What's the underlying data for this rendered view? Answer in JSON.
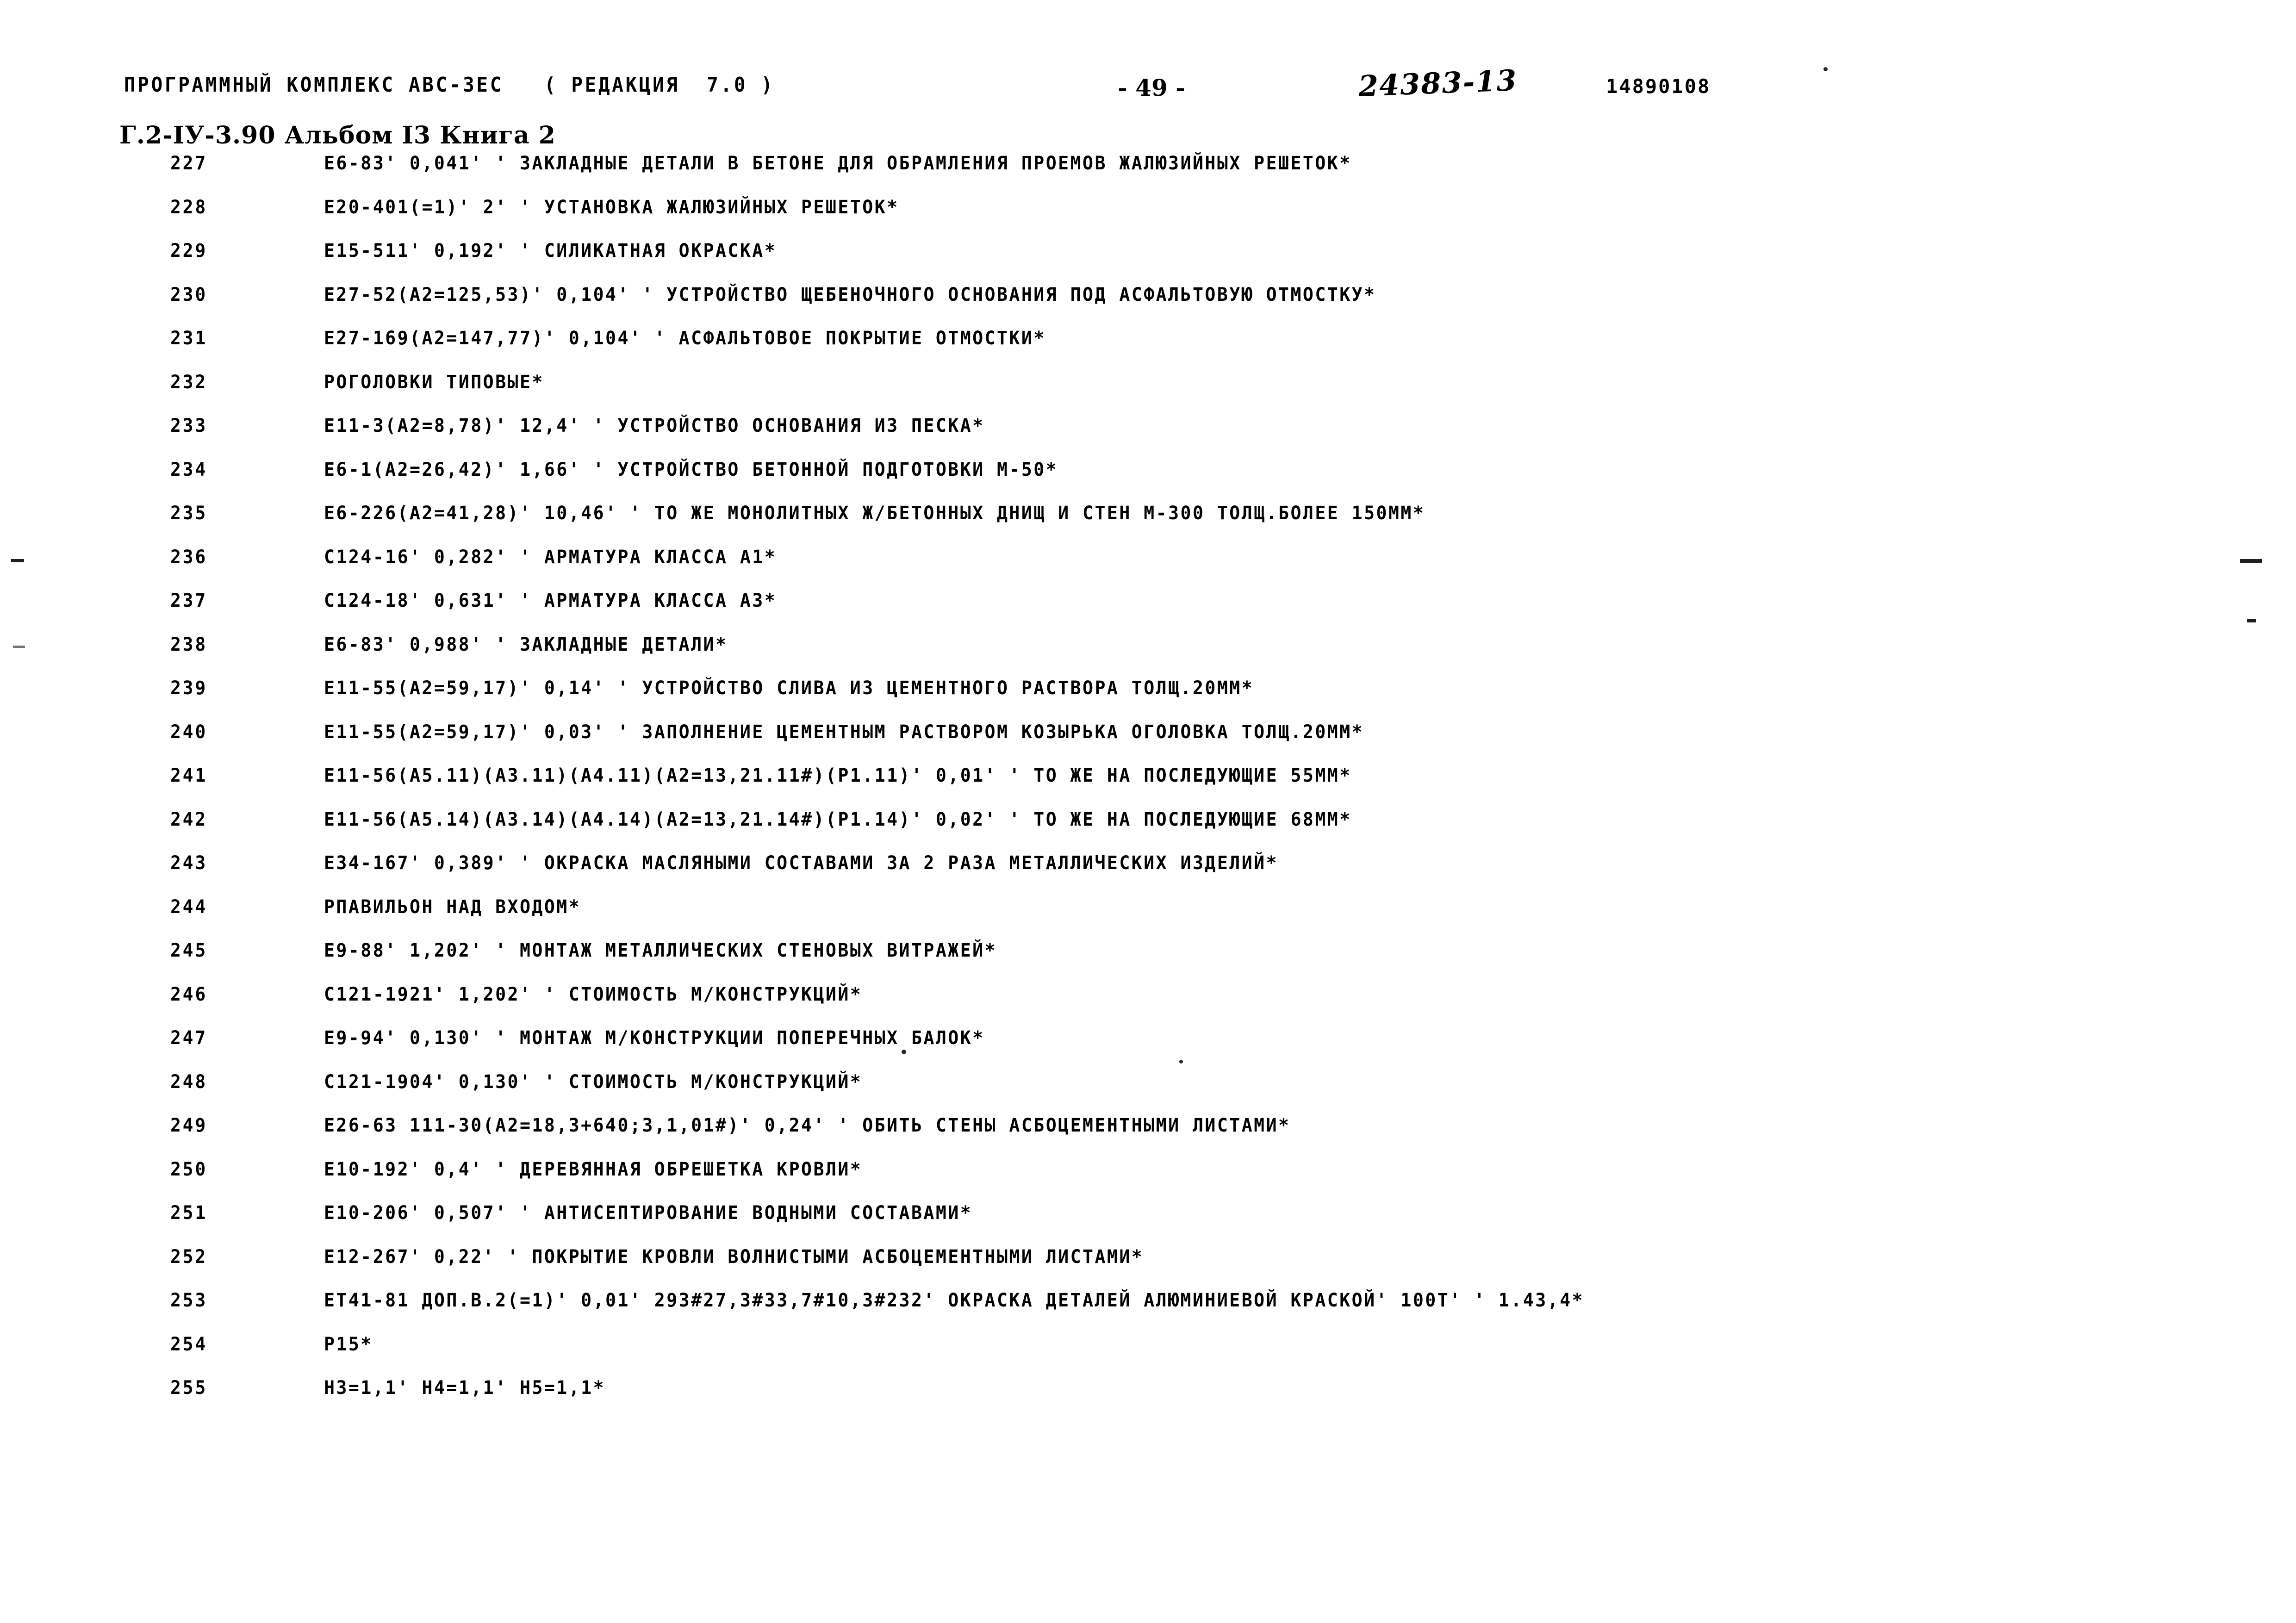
{
  "header": {
    "program_line": "ПРОГРАММНЫЙ КОМПЛЕКС АВС-3ЕС   ( РЕДАКЦИЯ  7.0 )",
    "album_line": "Г.2-IУ-3.90 Альбом I3 Книга 2",
    "page_number": "- 49 -",
    "handwritten_number": "24383-13",
    "stamp_code": "14890108"
  },
  "rows": [
    {
      "num": "227",
      "text": "Е6-83' 0,041' ' ЗАКЛАДНЫЕ ДЕТАЛИ В БЕТОНЕ ДЛЯ ОБРАМЛЕНИЯ ПРОЕМОВ ЖАЛЮЗИЙНЫХ РЕШЕТОК*"
    },
    {
      "num": "228",
      "text": "Е20-401(=1)' 2' ' УСТАНОВКА ЖАЛЮЗИЙНЫХ РЕШЕТОК*"
    },
    {
      "num": "229",
      "text": "Е15-511' 0,192' ' СИЛИКАТНАЯ ОКРАСКА*"
    },
    {
      "num": "230",
      "text": "Е27-52(А2=125,53)' 0,104' ' УСТРОЙСТВО ЩЕБЕНОЧНОГО ОСНОВАНИЯ ПОД АСФАЛЬТОВУЮ ОТМОСТКУ*"
    },
    {
      "num": "231",
      "text": "Е27-169(А2=147,77)' 0,104' ' АСФАЛЬТОВОЕ ПОКРЫТИЕ ОТМОСТКИ*"
    },
    {
      "num": "232",
      "text": "РОГОЛОВКИ ТИПОВЫЕ*"
    },
    {
      "num": "233",
      "text": "Е11-3(А2=8,78)' 12,4' ' УСТРОЙСТВО ОСНОВАНИЯ ИЗ ПЕСКА*"
    },
    {
      "num": "234",
      "text": "Е6-1(А2=26,42)' 1,66' ' УСТРОЙСТВО БЕТОННОЙ ПОДГОТОВКИ М-50*"
    },
    {
      "num": "235",
      "text": "Е6-226(А2=41,28)' 10,46' ' ТО ЖЕ МОНОЛИТНЫХ Ж/БЕТОННЫХ ДНИЩ И СТЕН М-300 ТОЛЩ.БОЛЕЕ 150ММ*"
    },
    {
      "num": "236",
      "text": "С124-16' 0,282' ' АРМАТУРА КЛАССА А1*"
    },
    {
      "num": "237",
      "text": "С124-18' 0,631' ' АРМАТУРА КЛАССА А3*"
    },
    {
      "num": "238",
      "text": "Е6-83' 0,988' ' ЗАКЛАДНЫЕ ДЕТАЛИ*"
    },
    {
      "num": "239",
      "text": "Е11-55(А2=59,17)' 0,14' ' УСТРОЙСТВО СЛИВА ИЗ ЦЕМЕНТНОГО РАСТВОРА ТОЛЩ.20ММ*"
    },
    {
      "num": "240",
      "text": "Е11-55(А2=59,17)' 0,03' ' ЗАПОЛНЕНИЕ ЦЕМЕНТНЫМ РАСТВОРОМ КОЗЫРЬКА ОГОЛОВКА ТОЛЩ.20ММ*"
    },
    {
      "num": "241",
      "text": "Е11-56(А5.11)(А3.11)(А4.11)(А2=13,21.11#)(Р1.11)' 0,01' ' ТО ЖЕ НА ПОСЛЕДУЮЩИЕ 55ММ*"
    },
    {
      "num": "242",
      "text": "Е11-56(А5.14)(А3.14)(А4.14)(А2=13,21.14#)(Р1.14)' 0,02' ' ТО ЖЕ НА ПОСЛЕДУЮЩИЕ 68ММ*"
    },
    {
      "num": "243",
      "text": "Е34-167' 0,389' ' ОКРАСКА МАСЛЯНЫМИ СОСТАВАМИ ЗА 2 РАЗА МЕТАЛЛИЧЕСКИХ ИЗДЕЛИЙ*"
    },
    {
      "num": "244",
      "text": "РПАВИЛЬОН НАД ВХОДОМ*"
    },
    {
      "num": "245",
      "text": "Е9-88' 1,202' ' МОНТАЖ МЕТАЛЛИЧЕСКИХ СТЕНОВЫХ ВИТРАЖЕЙ*"
    },
    {
      "num": "246",
      "text": "С121-1921' 1,202' ' СТОИМОСТЬ М/КОНСТРУКЦИЙ*"
    },
    {
      "num": "247",
      "text": "Е9-94' 0,130' ' МОНТАЖ М/КОНСТРУКЦИИ ПОПЕРЕЧНЫХ БАЛОК*"
    },
    {
      "num": "248",
      "text": "С121-1904' 0,130' ' СТОИМОСТЬ М/КОНСТРУКЦИЙ*"
    },
    {
      "num": "249",
      "text": "Е26-63 111-30(А2=18,3+640;3,1,01#)' 0,24' ' ОБИТЬ СТЕНЫ АСБОЦЕМЕНТНЫМИ ЛИСТАМИ*"
    },
    {
      "num": "250",
      "text": "Е10-192' 0,4' ' ДЕРЕВЯННАЯ ОБРЕШЕТКА КРОВЛИ*"
    },
    {
      "num": "251",
      "text": "Е10-206' 0,507' ' АНТИСЕПТИРОВАНИЕ ВОДНЫМИ СОСТАВАМИ*"
    },
    {
      "num": "252",
      "text": "Е12-267' 0,22' ' ПОКРЫТИЕ КРОВЛИ ВОЛНИСТЫМИ АСБОЦЕМЕНТНЫМИ ЛИСТАМИ*"
    },
    {
      "num": "253",
      "text": "ЕТ41-81 ДОП.В.2(=1)' 0,01' 293#27,3#33,7#10,3#232' ОКРАСКА ДЕТАЛЕЙ АЛЮМИНИЕВОЙ КРАСКОЙ' 100Т' ' 1.43,4*"
    },
    {
      "num": "254",
      "text": "Р15*"
    },
    {
      "num": "255",
      "text": "Н3=1,1' Н4=1,1' Н5=1,1*"
    }
  ]
}
